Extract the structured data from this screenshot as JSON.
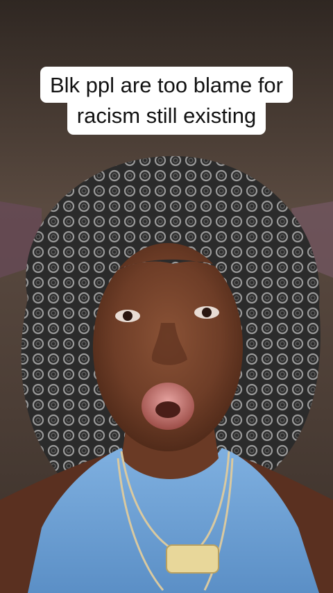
{
  "caption": {
    "line1": "Blk ppl are too blame for",
    "line2": "racism still existing"
  },
  "colors": {
    "wall": "#4a3c33",
    "skin": "#7a4530",
    "hair": "#3a3a3a",
    "top": "#6fa2d6",
    "caption_bg": "#ffffff",
    "caption_text": "#111111"
  }
}
